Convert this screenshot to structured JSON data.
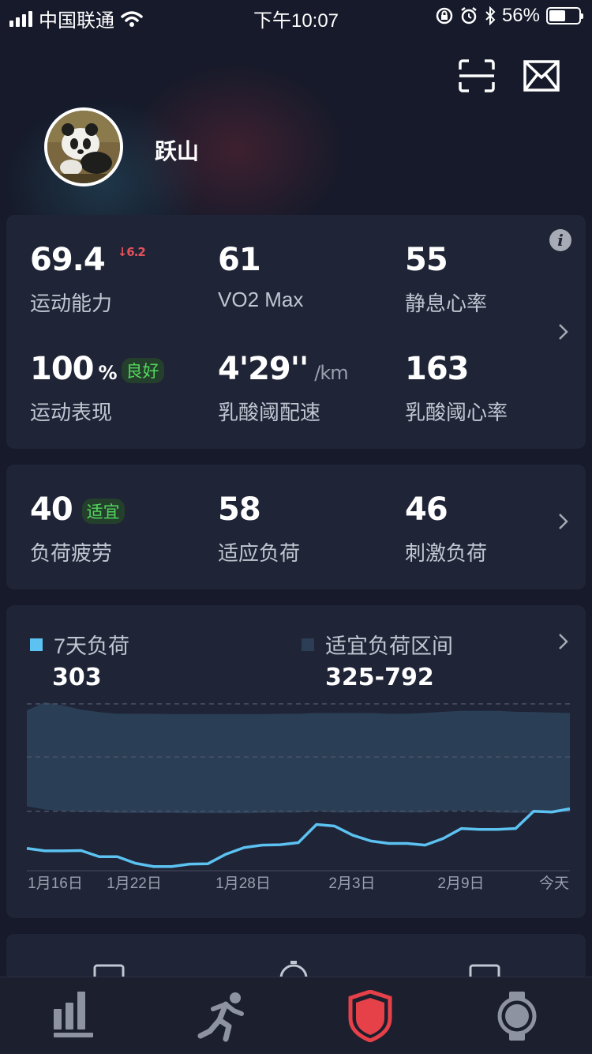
{
  "status_bar": {
    "carrier": "中国联通",
    "time": "下午10:07",
    "battery": "56%",
    "battery_level": 0.56
  },
  "profile": {
    "username": "跃山"
  },
  "top_icons": [
    "scan-icon",
    "mail-icon"
  ],
  "fitness": {
    "metrics": [
      {
        "value": "69.4",
        "delta": "6.2",
        "delta_direction": "down",
        "label": "运动能力"
      },
      {
        "value": "61",
        "label": "VO2 Max"
      },
      {
        "value": "55",
        "label": "静息心率"
      },
      {
        "value": "100",
        "unit": "%",
        "badge": "良好",
        "label": "运动表现"
      },
      {
        "value": "4'29''",
        "unit": "/km",
        "label": "乳酸阈配速"
      },
      {
        "value": "163",
        "label": "乳酸阈心率"
      }
    ]
  },
  "load": {
    "metrics": [
      {
        "value": "40",
        "badge": "适宜",
        "label": "负荷疲劳"
      },
      {
        "value": "58",
        "label": "适应负荷"
      },
      {
        "value": "46",
        "label": "刺激负荷"
      }
    ]
  },
  "load_chart": {
    "legend": [
      {
        "label": "7天负荷",
        "value": "303",
        "color": "#5cc2f2"
      },
      {
        "label": "适宜负荷区间",
        "value": "325-792",
        "color": "#2c3e55"
      }
    ],
    "x_ticks": [
      "1月16日",
      "1月22日",
      "1月28日",
      "2月3日",
      "2月9日",
      "今天"
    ]
  },
  "chart_data": {
    "type": "area",
    "title": "",
    "xlabel": "",
    "ylabel": "",
    "x_tick_labels": [
      "1月16日",
      "1月22日",
      "1月28日",
      "2月3日",
      "2月9日",
      "今天"
    ],
    "ylim": [
      0,
      1100
    ],
    "series": [
      {
        "name": "7天负荷",
        "type": "line",
        "color": "#5cc2f2",
        "values": [
          135,
          120,
          120,
          122,
          85,
          85,
          45,
          25,
          25,
          40,
          42,
          100,
          140,
          155,
          157,
          170,
          280,
          270,
          215,
          180,
          165,
          165,
          155,
          195,
          255,
          250,
          250,
          255,
          360,
          355,
          375
        ]
      },
      {
        "name": "适宜负荷区间",
        "type": "band",
        "color": "#2a3e55",
        "upper": [
          970,
          1020,
          1000,
          975,
          960,
          950,
          950,
          950,
          948,
          948,
          948,
          948,
          948,
          948,
          950,
          950,
          955,
          955,
          955,
          955,
          950,
          950,
          955,
          962,
          968,
          968,
          968,
          962,
          960,
          958,
          955
        ],
        "lower": [
          390,
          370,
          360,
          355,
          355,
          350,
          350,
          350,
          350,
          348,
          348,
          348,
          348,
          350,
          352,
          352,
          360,
          352,
          352,
          355,
          355,
          352,
          352,
          362,
          362,
          360,
          352,
          350,
          350,
          352,
          355
        ]
      }
    ],
    "reference_lines": [
      360,
      688,
      1010
    ],
    "grid": true,
    "legend_position": "top"
  },
  "tabs": [
    {
      "name": "data-tab",
      "icon": "bar-chart-icon"
    },
    {
      "name": "workout-tab",
      "icon": "runner-icon"
    },
    {
      "name": "shield-tab",
      "icon": "shield-icon",
      "active": true,
      "color": "#e64048"
    },
    {
      "name": "device-tab",
      "icon": "watch-icon"
    }
  ]
}
